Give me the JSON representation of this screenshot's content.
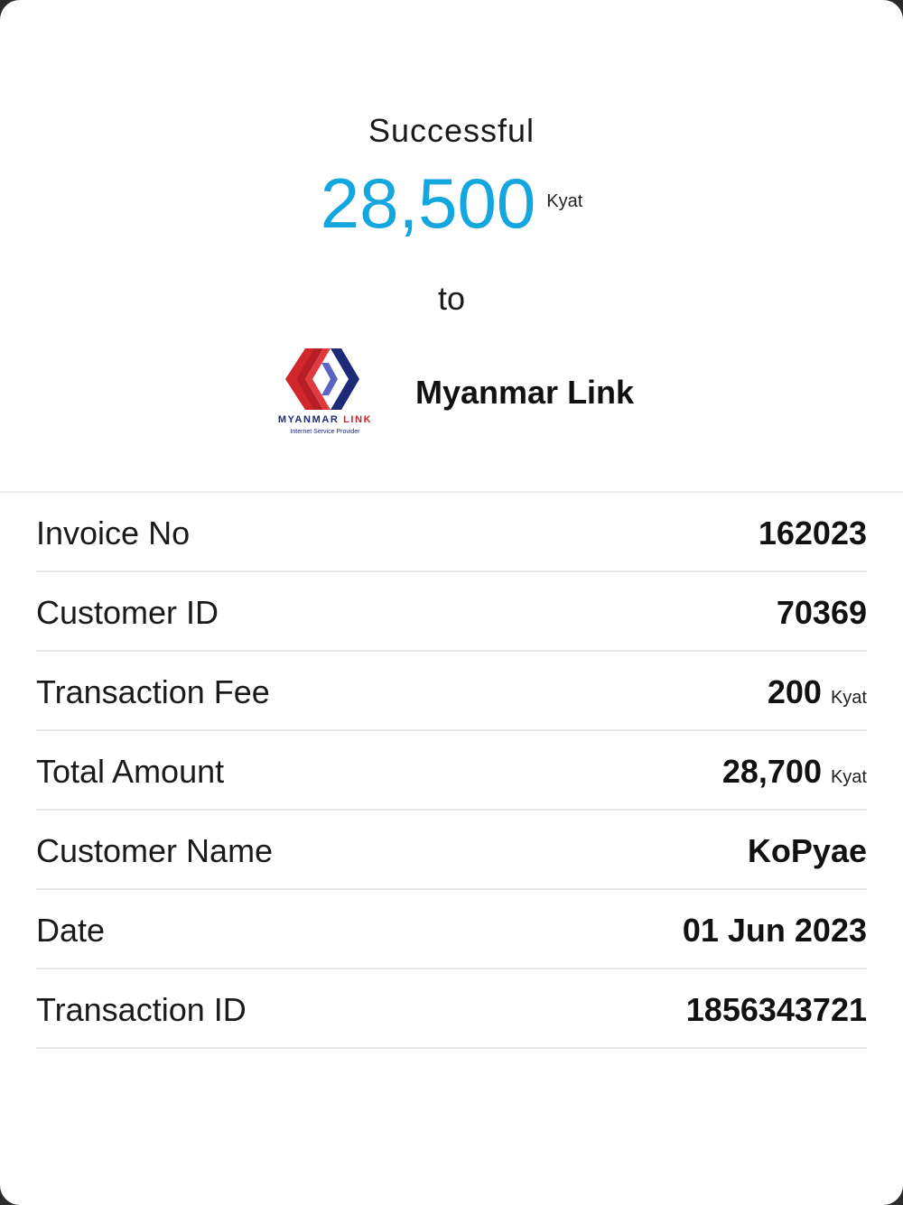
{
  "header": {
    "status": "Successful",
    "amount": "28,500",
    "amount_unit": "Kyat",
    "to_label": "to"
  },
  "merchant": {
    "name": "Myanmar Link",
    "logo_text_a": "MYANMAR ",
    "logo_text_b": "LINK",
    "logo_sub": "Internet Service Provider",
    "logo_colors": {
      "red": "#d0262c",
      "blue": "#1d2a7a",
      "light_blue": "#5b63c4"
    }
  },
  "details": {
    "invoice_no": {
      "label": "Invoice No",
      "value": "162023"
    },
    "customer_id": {
      "label": "Customer ID",
      "value": "70369"
    },
    "transaction_fee": {
      "label": "Transaction Fee",
      "value": "200",
      "unit": "Kyat"
    },
    "total_amount": {
      "label": "Total Amount",
      "value": "28,700",
      "unit": "Kyat"
    },
    "customer_name": {
      "label": "Customer Name",
      "value": "KoPyae"
    },
    "date": {
      "label": "Date",
      "value": "01 Jun 2023"
    },
    "transaction_id": {
      "label": "Transaction ID",
      "value": "1856343721"
    }
  },
  "colors": {
    "accent": "#14a6df",
    "background": "#ffffff",
    "divider": "#e6e6e6"
  }
}
